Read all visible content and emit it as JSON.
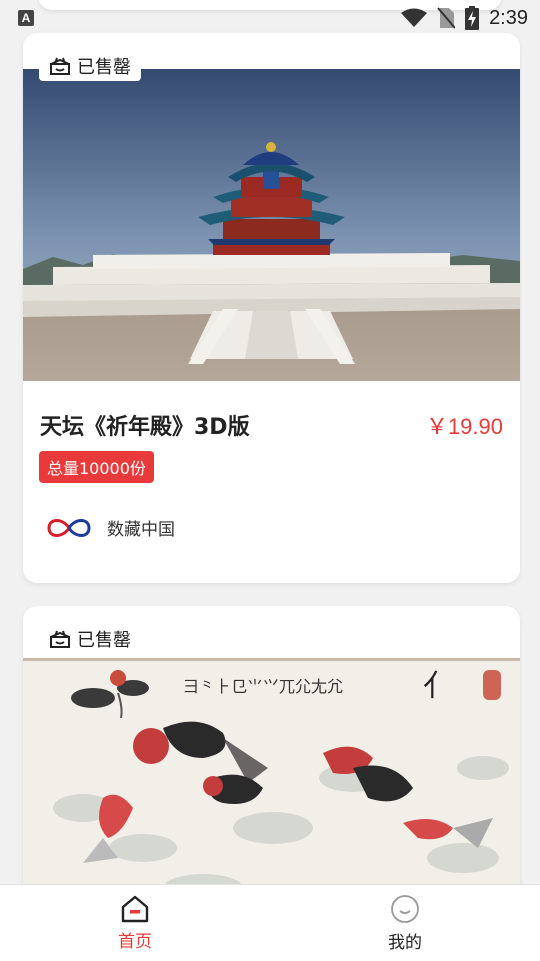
{
  "status_bar": {
    "time": "2:39",
    "notification_icon": "A"
  },
  "products": [
    {
      "sold_label": "已售罄",
      "title": "天坛《祈年殿》3D版",
      "price": "￥19.90",
      "total": "总量10000份",
      "brand": "数藏中国",
      "image_icon": "temple-of-heaven-image"
    },
    {
      "sold_label": "已售罄",
      "image_icon": "goldfish-painting-image"
    }
  ],
  "tabbar": {
    "home_label": "首页",
    "mine_label": "我的"
  },
  "colors": {
    "accent": "#e83a3a"
  }
}
